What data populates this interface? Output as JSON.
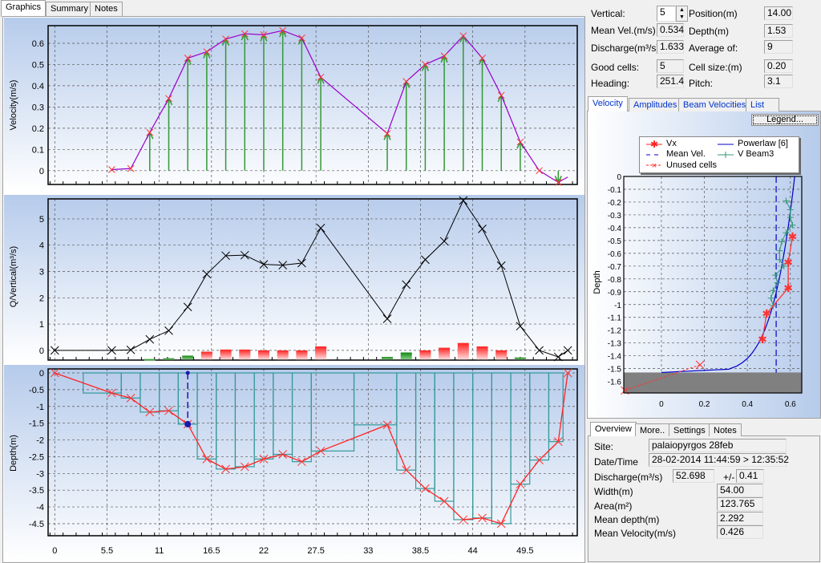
{
  "main_tabs": [
    {
      "label": "Graphics"
    },
    {
      "label": "Summary"
    },
    {
      "label": "Notes"
    }
  ],
  "vertical_info": {
    "vertical_label": "Vertical:",
    "vertical_value": "5",
    "position_label": "Position(m)",
    "position_value": "14.00",
    "mean_vel_label": "Mean Vel.(m/s)",
    "mean_vel_value": "0.534",
    "depth_label": "Depth(m)",
    "depth_value": "1.53",
    "discharge_label": "Discharge(m³/s)",
    "discharge_value": "1.633",
    "average_label": "Average of:",
    "average_value": "9",
    "good_cells_label": "Good cells:",
    "good_cells_value": "5",
    "cell_size_label": "Cell size:(m)",
    "cell_size_value": "0.20",
    "heading_label": "Heading:",
    "heading_value": "251.4",
    "pitch_label": "Pitch:",
    "pitch_value": "3.1"
  },
  "profile_tabs": [
    {
      "label": "Velocity"
    },
    {
      "label": "Amplitudes"
    },
    {
      "label": "Beam Velocities"
    },
    {
      "label": "List"
    }
  ],
  "legend_button": "Legend...",
  "legend": {
    "vx": "Vx",
    "powerlaw": "Powerlaw [6]",
    "mean_vel": "Mean Vel.",
    "beam3": "V Beam3",
    "unused": "Unused cells"
  },
  "summary_tabs": [
    {
      "label": "Overview"
    },
    {
      "label": "More.."
    },
    {
      "label": "Settings"
    },
    {
      "label": "Notes"
    }
  ],
  "overview": {
    "site_label": "Site:",
    "site_value": "palaiopyrgos 28feb",
    "datetime_label": "Date/Time",
    "datetime_value": "28-02-2014 11:44:59 > 12:35:52",
    "discharge_label": "Discharge(m³/s)",
    "discharge_value": "52.698",
    "pm_label": "+/-",
    "pm_value": "0.41",
    "width_label": "Width(m)",
    "width_value": "54.00",
    "area_label": "Area(m²)",
    "area_value": "123.765",
    "mean_depth_label": "Mean depth(m)",
    "mean_depth_value": "2.292",
    "mean_velocity_label": "Mean Velocity(m/s)",
    "mean_velocity_value": "0.426"
  },
  "colors": {
    "velocity_line": "#9900cc",
    "marker": "#ff3333",
    "arrow": "#339933",
    "q_line": "#000000",
    "bar_pos": "#ff3333",
    "bar_neg": "#339933",
    "depth_line": "#ff2222",
    "panel_outline": "#339999",
    "selected": "#1a1aaa",
    "powerlaw": "#0000cc",
    "beam3": "#339977",
    "bed": "#808080"
  },
  "chart_data": [
    {
      "type": "line",
      "ylabel": "Velocity(m/s)",
      "ylim": [
        -0.065,
        0.683
      ],
      "xlim": [
        -0.7,
        55
      ],
      "yticks": [
        "0",
        "0.1",
        "0.2",
        "0.3",
        "0.4",
        "0.5",
        "0.6"
      ],
      "ytick_values": [
        0,
        0.1,
        0.2,
        0.3,
        0.4,
        0.5,
        0.6
      ],
      "x": [
        6,
        8,
        10,
        12,
        14,
        16,
        18,
        20,
        22,
        24,
        26,
        28,
        35,
        37,
        39,
        41,
        43,
        45,
        47,
        49,
        51,
        53,
        54
      ],
      "y": [
        0.005,
        0.01,
        0.18,
        0.34,
        0.53,
        0.56,
        0.62,
        0.645,
        0.64,
        0.66,
        0.625,
        0.44,
        0.175,
        0.42,
        0.5,
        0.54,
        0.635,
        0.53,
        0.355,
        0.135,
        0.0,
        -0.055,
        -0.03
      ],
      "grid": true
    },
    {
      "type": "line",
      "ylabel": "Q/Vertical(m³/s)",
      "ylim": [
        -0.37,
        5.76
      ],
      "xlim": [
        -0.7,
        55
      ],
      "yticks": [
        "0",
        "1",
        "2",
        "3",
        "4",
        "5"
      ],
      "ytick_values": [
        0,
        1,
        2,
        3,
        4,
        5
      ],
      "x": [
        0,
        6,
        8,
        10,
        12,
        14,
        16,
        18,
        20,
        22,
        24,
        26,
        28,
        35,
        37,
        39,
        41,
        43,
        45,
        47,
        49,
        51,
        53,
        54
      ],
      "y": [
        0,
        0,
        0.02,
        0.42,
        0.75,
        1.65,
        2.9,
        3.6,
        3.62,
        3.27,
        3.24,
        3.32,
        4.65,
        1.2,
        2.5,
        3.45,
        4.15,
        5.7,
        4.62,
        3.22,
        0.92,
        0,
        -0.25,
        0
      ],
      "bars_baseline": -0.35,
      "bars": {
        "x": [
          10,
          12,
          14,
          16,
          18,
          20,
          22,
          24,
          26,
          28,
          35,
          37,
          39,
          41,
          43,
          45,
          47,
          49
        ],
        "top": [
          -0.33,
          -0.3,
          -0.2,
          -0.05,
          0.03,
          0.03,
          0,
          0,
          0,
          0.15,
          -0.25,
          -0.08,
          0,
          0.1,
          0.28,
          0.15,
          0,
          -0.27
        ],
        "sign": [
          "neg",
          "neg",
          "neg",
          "pos",
          "pos",
          "pos",
          "pos",
          "pos",
          "pos",
          "pos",
          "neg",
          "neg",
          "pos",
          "pos",
          "pos",
          "pos",
          "pos",
          "neg"
        ]
      },
      "grid": true
    },
    {
      "type": "line",
      "ylabel": "Depth(m)",
      "ylim": [
        -4.86,
        0.12
      ],
      "xlim": [
        -0.7,
        55
      ],
      "yticks": [
        "0",
        "-0.5",
        "-1",
        "-1.5",
        "-2",
        "-2.5",
        "-3",
        "-3.5",
        "-4",
        "-4.5"
      ],
      "ytick_values": [
        0,
        -0.5,
        -1,
        -1.5,
        -2,
        -2.5,
        -3,
        -3.5,
        -4,
        -4.5
      ],
      "xticks": [
        "0",
        "5.5",
        "11",
        "16.5",
        "22",
        "27.5",
        "33",
        "38.5",
        "44",
        "49.5"
      ],
      "xtick_values": [
        0,
        5.5,
        11,
        16.5,
        22,
        27.5,
        33,
        38.5,
        44,
        49.5
      ],
      "x": [
        0,
        6,
        8,
        10,
        12,
        14,
        16,
        18,
        20,
        22,
        24,
        26,
        28,
        35,
        37,
        39,
        41,
        43,
        45,
        47,
        49,
        51,
        53,
        54
      ],
      "y": [
        0,
        -0.6,
        -0.75,
        -1.17,
        -1.13,
        -1.53,
        -2.57,
        -2.87,
        -2.8,
        -2.57,
        -2.43,
        -2.65,
        -2.33,
        -1.55,
        -2.9,
        -3.45,
        -3.83,
        -4.38,
        -4.33,
        -4.5,
        -3.32,
        -2.6,
        -2.05,
        0
      ],
      "selected_x": 14,
      "grid": true
    },
    {
      "type": "scatter",
      "ylabel": "Depth",
      "xlim": [
        -0.175,
        0.653
      ],
      "ylim": [
        -1.69,
        0
      ],
      "yticks": [
        "0",
        "-0.1",
        "-0.2",
        "-0.3",
        "-0.4",
        "-0.5",
        "-0.6",
        "-0.7",
        "-0.8",
        "-0.9",
        "-1",
        "-1.1",
        "-1.2",
        "-1.3",
        "-1.4",
        "-1.5",
        "-1.6"
      ],
      "ytick_values": [
        0,
        -0.1,
        -0.2,
        -0.3,
        -0.4,
        -0.5,
        -0.6,
        -0.7,
        -0.8,
        -0.9,
        -1,
        -1.1,
        -1.2,
        -1.3,
        -1.4,
        -1.5,
        -1.6
      ],
      "xticks": [
        "0",
        "0.2",
        "0.4",
        "0.6"
      ],
      "xtick_values": [
        0,
        0.2,
        0.4,
        0.6
      ],
      "bed_depth": -1.53,
      "mean_vel": 0.534,
      "powerlaw": {
        "surface_velocity": 0.62,
        "exponent": 6,
        "depth": 1.53
      },
      "series": [
        {
          "name": "Vx",
          "x": [
            0.61,
            0.59,
            0.59,
            0.49,
            0.47
          ],
          "y": [
            -0.47,
            -0.67,
            -0.87,
            -1.07,
            -1.27
          ]
        },
        {
          "name": "Unused cells",
          "x": [
            0.18,
            -0.17
          ],
          "y": [
            -1.47,
            -1.67
          ]
        },
        {
          "name": "V Beam3",
          "x": [
            0.58,
            0.6,
            0.6,
            0.61,
            0.58,
            0.56,
            0.55,
            0.55,
            0.57,
            0.53,
            0.54,
            0.52,
            0.51,
            0.52
          ],
          "y": [
            -0.19,
            -0.26,
            -0.32,
            -0.38,
            -0.44,
            -0.51,
            -0.58,
            -0.65,
            -0.7,
            -0.77,
            -0.83,
            -0.89,
            -0.95,
            -1.01
          ]
        }
      ],
      "grid": true
    }
  ]
}
